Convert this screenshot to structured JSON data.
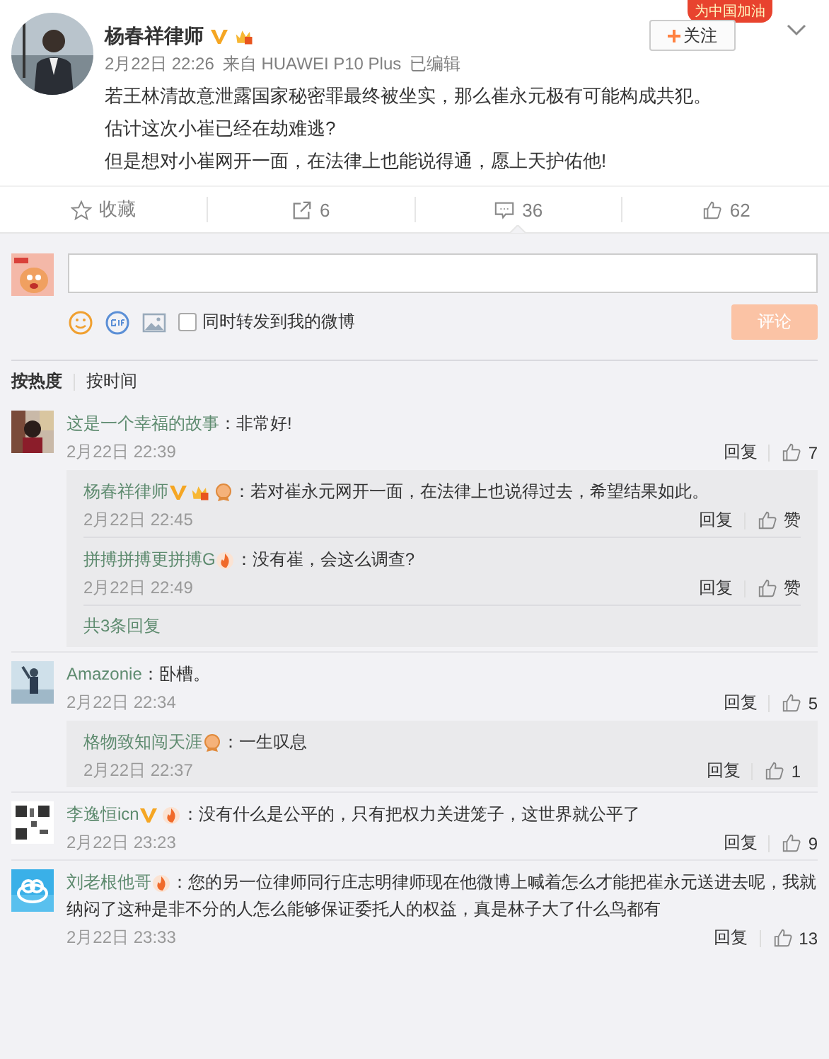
{
  "post": {
    "author": "杨春祥律师",
    "badges": [
      {
        "kind": "verified"
      },
      {
        "kind": "vip"
      }
    ],
    "campaign_badge": "为中国加油",
    "follow_button": "关注",
    "time": "2月22日 22:26",
    "source": "来自 HUAWEI P10 Plus",
    "edited": "已编辑",
    "lines": [
      "若王林清故意泄露国家秘密罪最终被坐实，那么崔永元极有可能构成共犯。",
      "估计这次小崔已经在劫难逃?",
      "但是想对小崔网开一面，在法律上也能说得通，愿上天护佑他!"
    ]
  },
  "actions": [
    {
      "kind": "favorite",
      "label": "收藏",
      "selected": false
    },
    {
      "kind": "repost",
      "label": "6",
      "selected": false
    },
    {
      "kind": "comment",
      "label": "36",
      "selected": true
    },
    {
      "kind": "like",
      "label": "62",
      "selected": false
    }
  ],
  "composer": {
    "repost_checkbox": {
      "label": "同时转发到我的微博",
      "checked": false
    },
    "submit": {
      "label": "评论",
      "disabled": true
    }
  },
  "sort_tabs": [
    {
      "label": "按热度",
      "selected": true
    },
    {
      "label": "按时间",
      "selected": false
    }
  ],
  "comments": [
    {
      "author": "这是一个幸福的故事",
      "text": "：非常好!",
      "time": "2月22日 22:39",
      "reply": "回复",
      "likes": "7",
      "replies": [
        {
          "author": "杨春祥律师",
          "badges": [
            {
              "kind": "verified"
            },
            {
              "kind": "vip"
            },
            {
              "kind": "medal"
            }
          ],
          "text": "：若对崔永元网开一面，在法律上也说得过去，希望结果如此。",
          "time": "2月22日 22:45",
          "reply": "回复",
          "likes": "赞"
        },
        {
          "author": "拼搏拼搏更拼搏G",
          "badges": [
            {
              "kind": "fire"
            }
          ],
          "text": "：没有崔，会这么调查?",
          "time": "2月22日 22:49",
          "reply": "回复",
          "likes": "赞"
        }
      ],
      "more": "共3条回复"
    },
    {
      "author": "Amazonie",
      "text": "：卧槽。",
      "time": "2月22日 22:34",
      "reply": "回复",
      "likes": "5",
      "replies": [
        {
          "author": "格物致知闯天涯",
          "badges": [
            {
              "kind": "medal"
            }
          ],
          "text": "：一生叹息",
          "time": "2月22日 22:37",
          "reply": "回复",
          "likes": "1"
        }
      ]
    },
    {
      "author": "李逸恒icn",
      "badges": [
        {
          "kind": "verified"
        },
        {
          "kind": "fire"
        }
      ],
      "text": "：没有什么是公平的，只有把权力关进笼子，这世界就公平了",
      "time": "2月22日 23:23",
      "reply": "回复",
      "likes": "9"
    },
    {
      "author": "刘老根他哥",
      "badges": [
        {
          "kind": "fire"
        }
      ],
      "text": "：您的另一位律师同行庄志明律师现在他微博上喊着怎么才能把崔永元送进去呢，我就纳闷了这种是非不分的人怎么能够保证委托人的权益，真是林子大了什么鸟都有",
      "time": "2月22日 23:33",
      "reply": "回复",
      "likes": "13"
    }
  ]
}
